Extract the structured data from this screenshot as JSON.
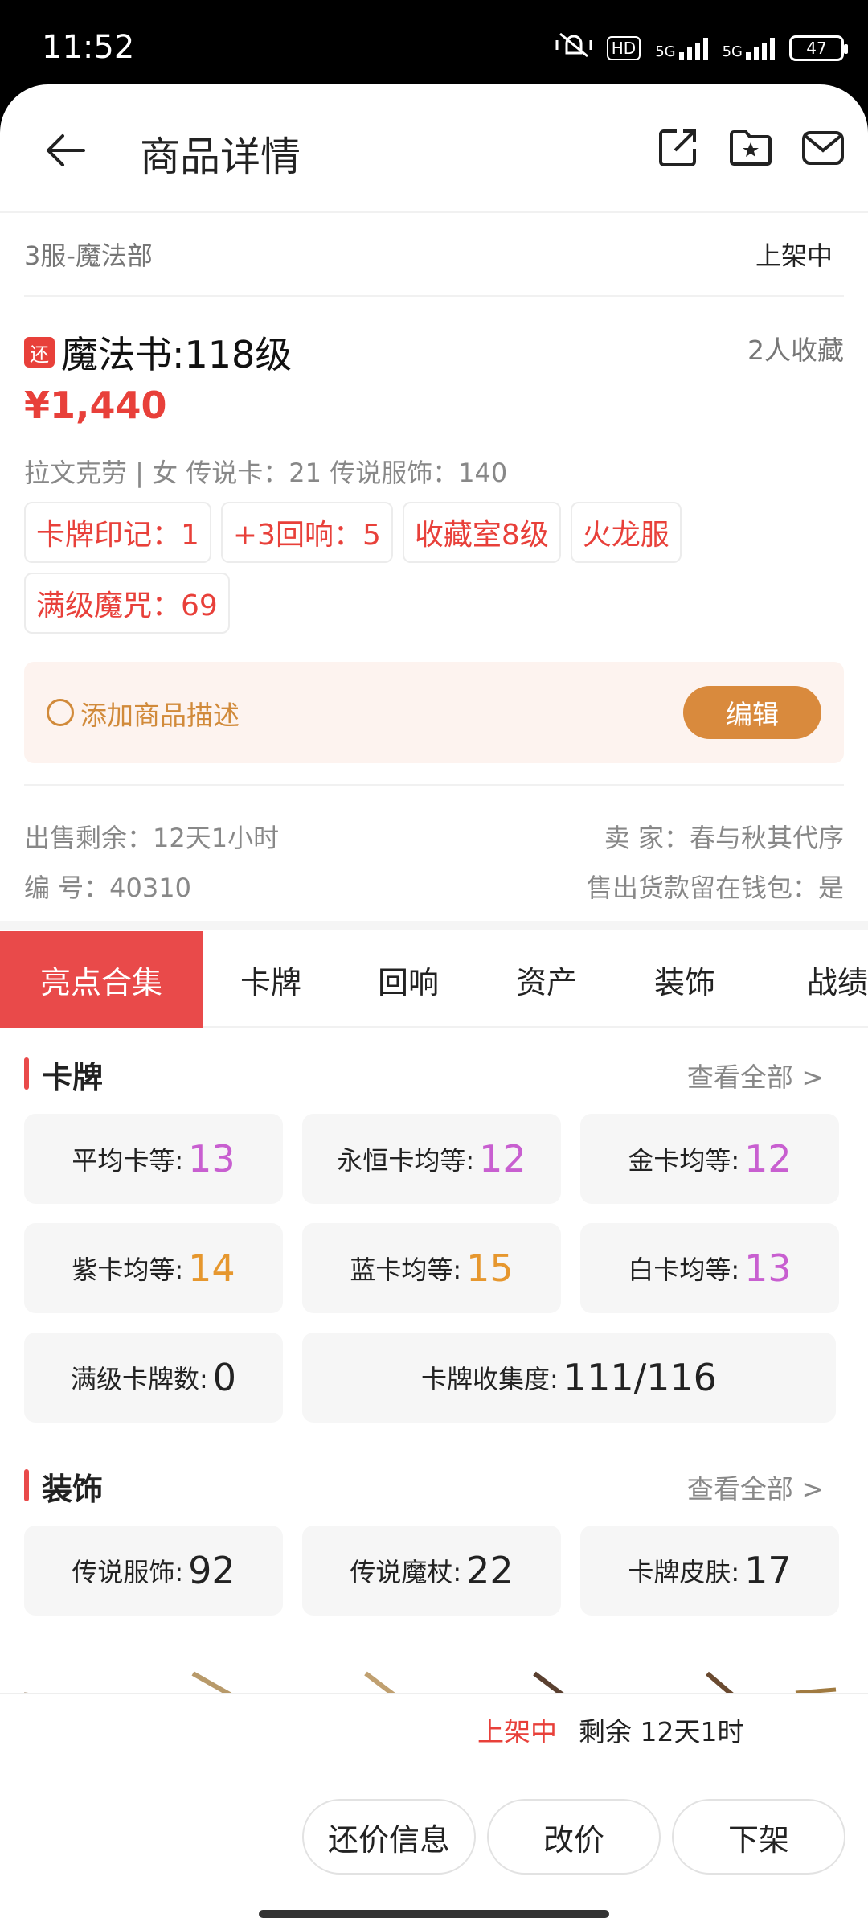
{
  "status_bar": {
    "time": "11:52",
    "hd": "HD",
    "net1": "5G",
    "net2": "5G",
    "battery": "47"
  },
  "header": {
    "title": "商品详情"
  },
  "server_row": {
    "server": "3服-魔法部",
    "status": "上架中"
  },
  "product": {
    "tag": "还",
    "name": "魔法书:118级",
    "favorites": "2人收藏",
    "price": "¥1,440",
    "meta": "拉文克劳 | 女 传说卡：21 传说服饰：140",
    "chips": [
      "卡牌印记：1",
      "+3回响：5",
      "收藏室8级",
      "火龙服",
      "满级魔咒：69"
    ]
  },
  "description": {
    "placeholder": "添加商品描述",
    "edit_label": "编辑"
  },
  "info": {
    "remaining_label": "出售剩余：12天1小时",
    "id_label": "编 号：40310",
    "seller_label": "卖 家：春与秋其代序",
    "wallet_label": "售出货款留在钱包：是"
  },
  "tabs": [
    "亮点合集",
    "卡牌",
    "回响",
    "资产",
    "装饰",
    "战绩"
  ],
  "cards_section": {
    "title": "卡牌",
    "more": "查看全部 >",
    "items": [
      {
        "label": "平均卡等:",
        "value": "13"
      },
      {
        "label": "永恒卡均等:",
        "value": "12"
      },
      {
        "label": "金卡均等:",
        "value": "12"
      },
      {
        "label": "紫卡均等:",
        "value": "14"
      },
      {
        "label": "蓝卡均等:",
        "value": "15"
      },
      {
        "label": "白卡均等:",
        "value": "13"
      },
      {
        "label": "满级卡牌数:",
        "value": "0"
      },
      {
        "label": "卡牌收集度:",
        "value": "111/116"
      }
    ]
  },
  "decor_section": {
    "title": "装饰",
    "more": "查看全部 >",
    "items": [
      {
        "label": "传说服饰:",
        "value": "92"
      },
      {
        "label": "传说魔杖:",
        "value": "22"
      },
      {
        "label": "卡牌皮肤:",
        "value": "17"
      }
    ]
  },
  "bottom_bar": {
    "status": "上架中",
    "remaining": "剩余 12天1时",
    "buttons": [
      "还价信息",
      "改价",
      "下架"
    ]
  },
  "colors": {
    "accent": "#e94a4a",
    "price": "#e8403a",
    "orange": "#d98a3d",
    "purple": "#c85fd0"
  }
}
